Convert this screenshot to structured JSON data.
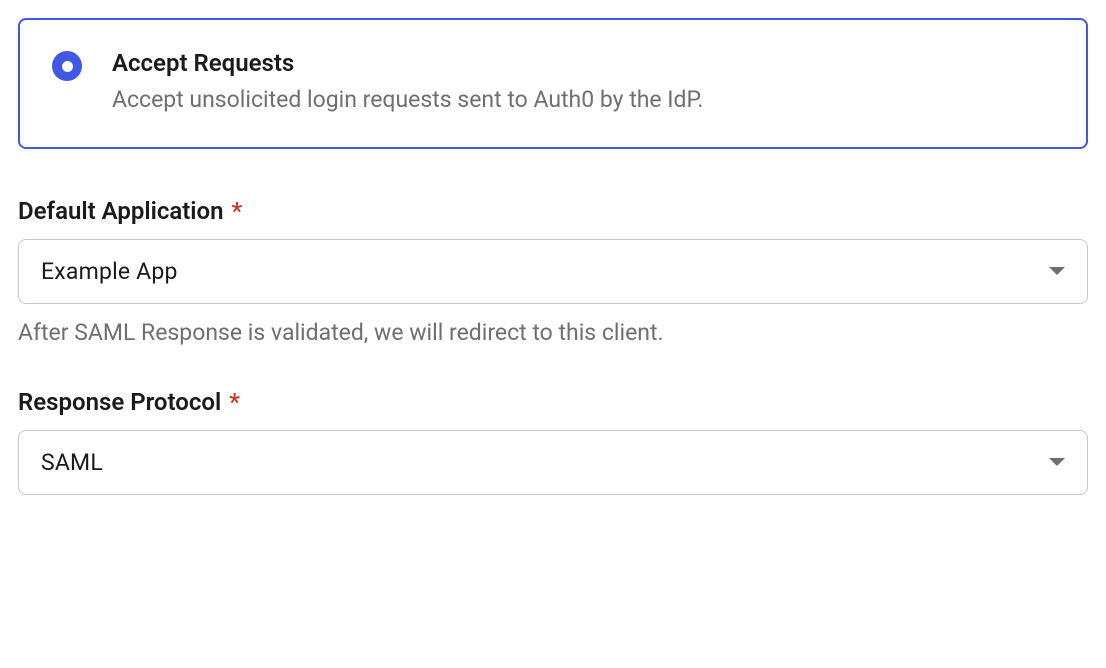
{
  "radioOption": {
    "title": "Accept Requests",
    "description": "Accept unsolicited login requests sent to Auth0 by the IdP."
  },
  "fields": {
    "defaultApplication": {
      "label": "Default Application",
      "required": "*",
      "value": "Example App",
      "helper": "After SAML Response is validated, we will redirect to this client."
    },
    "responseProtocol": {
      "label": "Response Protocol",
      "required": "*",
      "value": "SAML"
    }
  }
}
